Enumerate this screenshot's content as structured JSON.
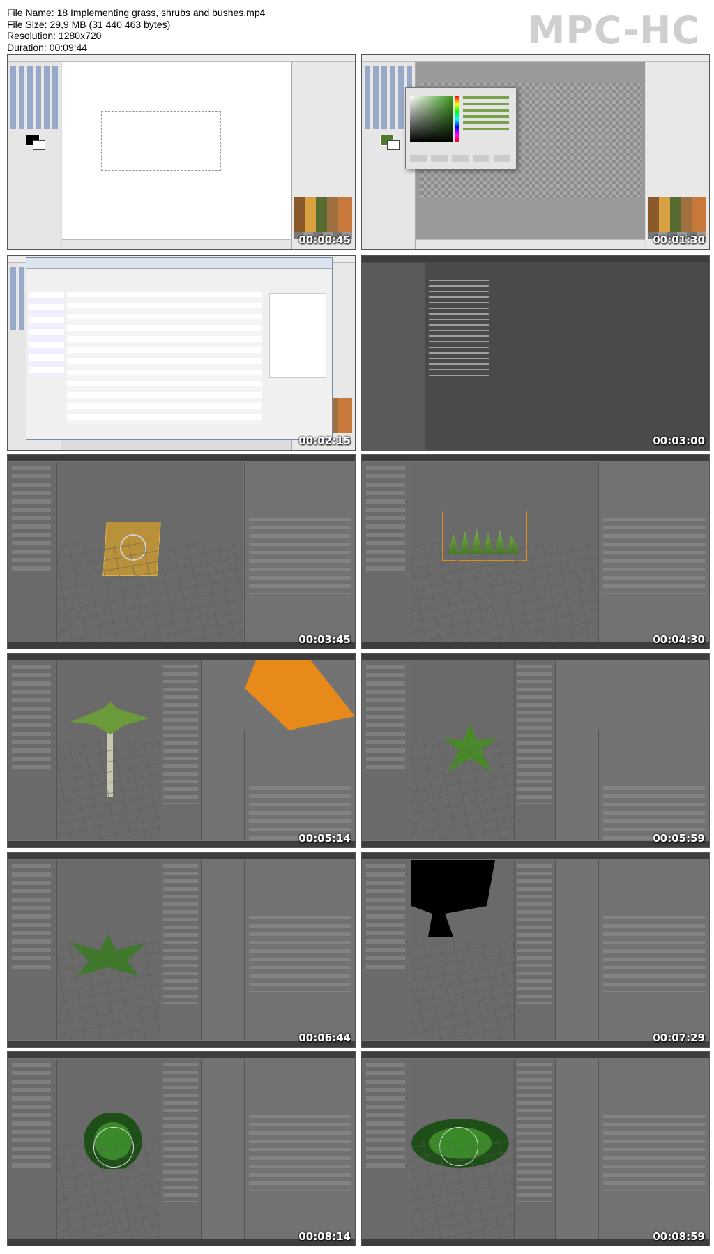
{
  "file_info": {
    "name_line": "File Name: 18 Implementing grass, shrubs and bushes.mp4",
    "size_line": "File Size: 29,9 MB (31 440 463 bytes)",
    "resolution_line": "Resolution: 1280x720",
    "duration_line": "Duration: 00:09:44"
  },
  "player_logo": "MPC-HC",
  "thumbnails": [
    {
      "timestamp": "00:00:45",
      "app": "GIMP"
    },
    {
      "timestamp": "00:01:30",
      "app": "GIMP"
    },
    {
      "timestamp": "00:02:15",
      "app": "GIMP"
    },
    {
      "timestamp": "00:03:00",
      "app": "Blender"
    },
    {
      "timestamp": "00:03:45",
      "app": "Blender"
    },
    {
      "timestamp": "00:04:30",
      "app": "Blender"
    },
    {
      "timestamp": "00:05:14",
      "app": "Blender"
    },
    {
      "timestamp": "00:05:59",
      "app": "Blender"
    },
    {
      "timestamp": "00:06:44",
      "app": "Blender"
    },
    {
      "timestamp": "00:07:29",
      "app": "Blender"
    },
    {
      "timestamp": "00:08:14",
      "app": "Blender"
    },
    {
      "timestamp": "00:08:59",
      "app": "Blender"
    }
  ]
}
